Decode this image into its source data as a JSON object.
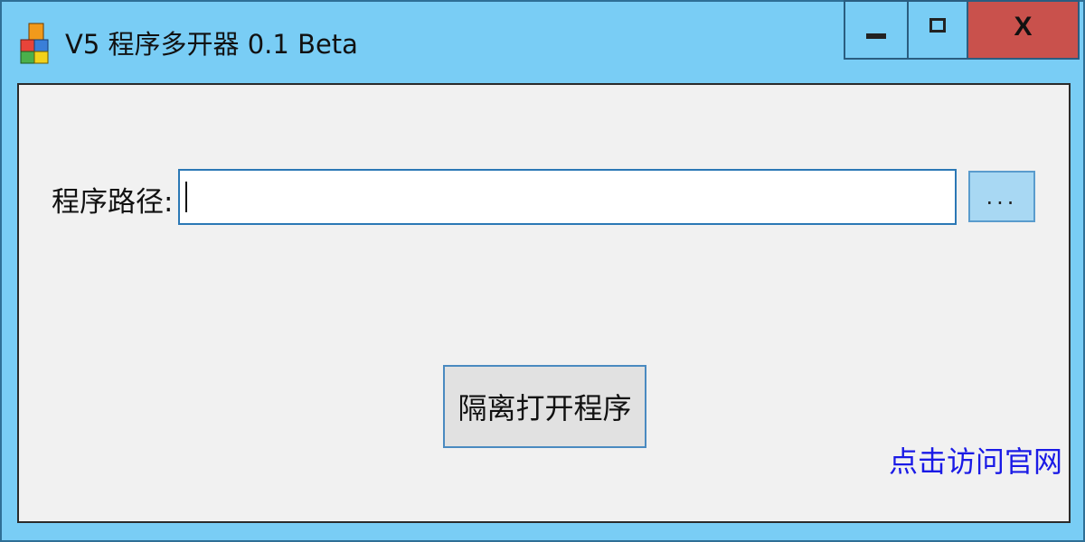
{
  "window": {
    "title": "V5 程序多开器 0.1 Beta",
    "icon": "app-blocks-icon",
    "controls": {
      "minimize_icon": "minimize-icon",
      "maximize_icon": "maximize-icon",
      "close_label": "X"
    }
  },
  "form": {
    "path_label": "程序路径:",
    "path_value": "",
    "browse_label": "...",
    "open_button_label": "隔离打开程序",
    "website_link": "点击访问官网"
  },
  "colors": {
    "title_bar": "#79cdf5",
    "close_button": "#c9514c",
    "client_bg": "#f1f1f1",
    "link": "#1a1ae6"
  }
}
